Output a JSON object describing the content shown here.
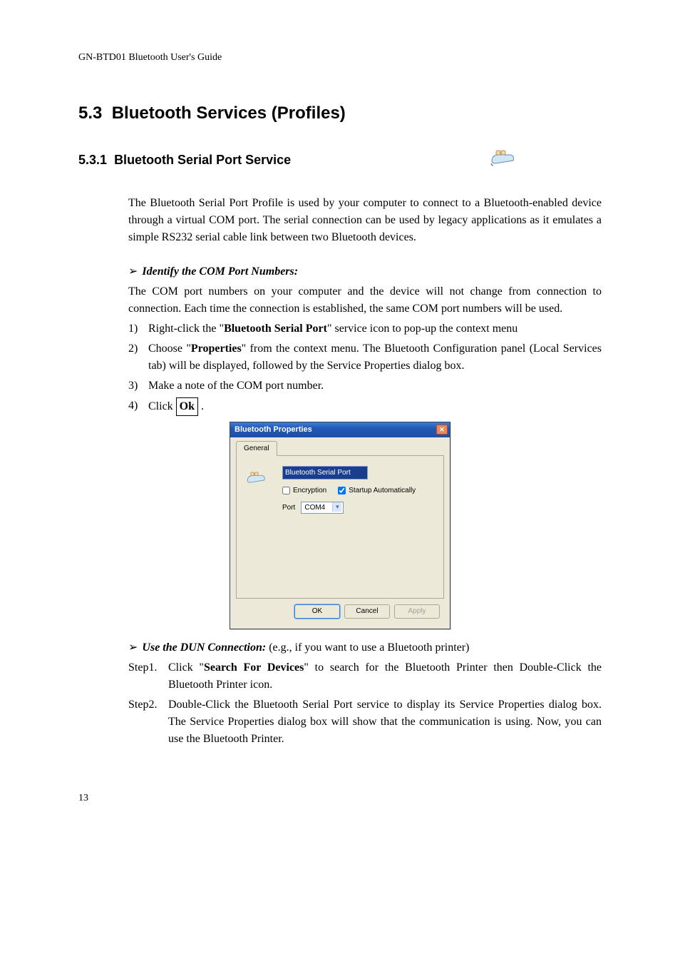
{
  "header": "GN-BTD01 Bluetooth User's Guide",
  "section": {
    "num": "5.3",
    "title": "Bluetooth Services (Profiles)"
  },
  "subsection": {
    "num": "5.3.1",
    "title": "Bluetooth Serial Port Service"
  },
  "intro_para": "The Bluetooth Serial Port Profile is used by your computer to connect to a Bluetooth-enabled device through a virtual COM port. The serial connection can be used by legacy applications as it emulates a simple RS232 serial cable link between two Bluetooth devices.",
  "identify_heading": "Identify the COM Port Numbers:",
  "identify_para": "The COM port numbers on your computer and the device will not change from connection to connection. Each time the connection is established, the same COM port numbers will be used.",
  "steps": {
    "s1_a": "Right-click the \"",
    "s1_b": "Bluetooth Serial Port",
    "s1_c": "\" service icon to pop-up the context menu",
    "s2_a": "Choose \"",
    "s2_b": "Properties",
    "s2_c": "\" from the context menu. The Bluetooth Configuration panel (Local Services tab) will be displayed, followed by the Service Properties dialog box.",
    "s3": "Make a note of the COM port number.",
    "s4_a": "Click ",
    "s4_ok": "Ok",
    "s4_b": " ."
  },
  "dialog": {
    "title": "Bluetooth Properties",
    "tab": "General",
    "service_name": "Bluetooth Serial Port",
    "encryption_label": "Encryption",
    "encryption_checked": false,
    "startup_label": "Startup Automatically",
    "startup_checked": true,
    "port_label": "Port",
    "port_value": "COM4",
    "ok": "OK",
    "cancel": "Cancel",
    "apply": "Apply"
  },
  "dun_heading": "Use the DUN Connection:",
  "dun_tail": "(e.g., if you want to use a Bluetooth printer)",
  "dun_step1_label": "Step1.",
  "dun_step1_a": "Click \"",
  "dun_step1_b": "Search For Devices",
  "dun_step1_c": "\" to search for the Bluetooth Printer then Double-Click the Bluetooth Printer icon.",
  "dun_step2_label": "Step2.",
  "dun_step2": "Double-Click the Bluetooth Serial Port service to display its Service Properties dialog box. The Service Properties dialog box will show that the communication is using. Now, you can use the Bluetooth Printer.",
  "page_number": "13"
}
